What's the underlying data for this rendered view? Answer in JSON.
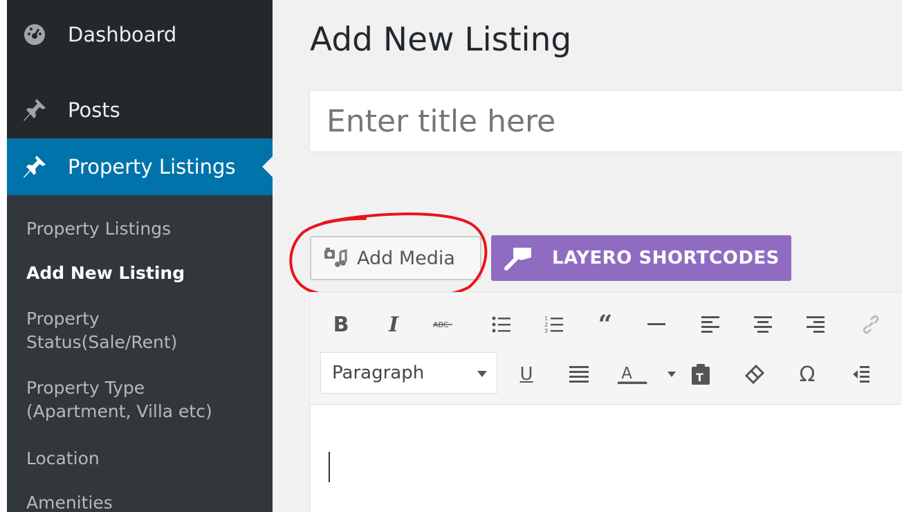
{
  "sidebar": {
    "menu": [
      {
        "label": "Dashboard",
        "icon": "dashboard-icon"
      },
      {
        "label": "Posts",
        "icon": "pin-icon"
      },
      {
        "label": "Property Listings",
        "icon": "pin-icon",
        "active": true
      }
    ],
    "submenu": [
      {
        "label": "Property Listings"
      },
      {
        "label": "Add New Listing",
        "current": true
      },
      {
        "label": "Property Status(Sale/Rent)"
      },
      {
        "label": "Property Type (Apartment, Villa etc)"
      },
      {
        "label": "Location"
      },
      {
        "label": "Amenities"
      }
    ]
  },
  "page": {
    "title": "Add New Listing",
    "title_placeholder": "Enter title here"
  },
  "media_buttons": {
    "add_media_label": "Add Media",
    "layero_label": "LAYERO SHORTCODES"
  },
  "toolbar": {
    "row1_icons": [
      "bold-icon",
      "italic-icon",
      "strikethrough-icon",
      "bullet-list-icon",
      "numbered-list-icon",
      "blockquote-icon",
      "horizontal-line-icon",
      "align-left-icon",
      "align-center-icon",
      "align-right-icon",
      "link-icon"
    ],
    "format_value": "Paragraph",
    "row2_icons": [
      "underline-icon",
      "justify-icon",
      "text-color-icon",
      "paste-text-icon",
      "clear-formatting-icon",
      "special-character-icon",
      "outdent-icon"
    ]
  },
  "colors": {
    "sidebar_bg": "#23282d",
    "submenu_bg": "#32373c",
    "active_bg": "#0073aa",
    "layero_bg": "#8f6cc1",
    "annotation_red": "#e8151b"
  }
}
